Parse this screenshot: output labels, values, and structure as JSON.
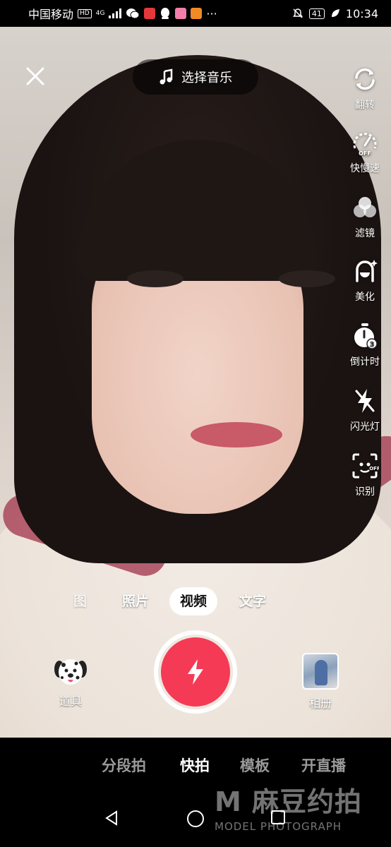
{
  "status_bar": {
    "carrier": "中国移动",
    "hd_badge": "HD",
    "network": "4G",
    "battery": "41",
    "time": "10:34"
  },
  "top": {
    "music_label": "选择音乐"
  },
  "toolbar": {
    "items": [
      {
        "label": "翻转",
        "icon": "flip-camera-icon"
      },
      {
        "label": "快慢速",
        "icon": "speed-gauge-icon"
      },
      {
        "label": "滤镜",
        "icon": "filter-icon"
      },
      {
        "label": "美化",
        "icon": "beauty-icon"
      },
      {
        "label": "倒计时",
        "icon": "timer-icon"
      },
      {
        "label": "闪光灯",
        "icon": "flash-off-icon"
      },
      {
        "label": "识别",
        "icon": "scan-icon"
      }
    ]
  },
  "mode_tabs": {
    "items": [
      "图",
      "照片",
      "视频",
      "文字"
    ],
    "active": "视频"
  },
  "bottom_controls": {
    "props_label": "道具",
    "album_label": "相册"
  },
  "bottom_tabs": {
    "items": [
      "分段拍",
      "快拍",
      "模板",
      "开直播"
    ],
    "active": "快拍"
  },
  "watermark": {
    "main": "M 麻豆约拍",
    "sub": "MODEL PHOTOGRAPH"
  },
  "colors": {
    "shutter": "#f53a55",
    "background": "#000000"
  }
}
